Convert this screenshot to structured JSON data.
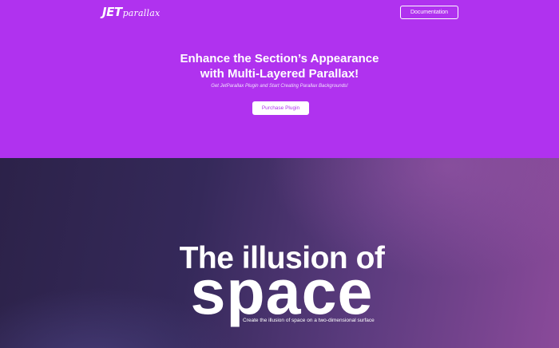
{
  "header": {
    "logo_primary": "JET",
    "logo_secondary": "parallax",
    "documentation_label": "Documentation"
  },
  "hero": {
    "title_line1": "Enhance the Section’s Appearance",
    "title_line2": "with Multi-Layered Parallax!",
    "subtitle": "Get JetParallax Plugin and Start Creating Parallax Backgrounds!",
    "purchase_label": "Purchase Plugin",
    "background_color": "#b032ef"
  },
  "parallax_section": {
    "title_line1": "The illusion of",
    "title_line2": "space",
    "subtitle": "Create the illusion of space on a two-dimensional surface"
  }
}
